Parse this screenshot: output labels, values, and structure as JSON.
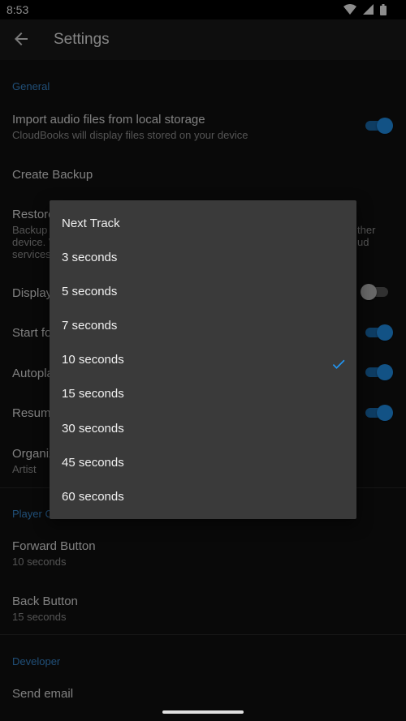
{
  "status_bar": {
    "time": "8:53"
  },
  "appbar": {
    "title": "Settings"
  },
  "sections": {
    "general": "General",
    "player": "Player C",
    "developer": "Developer"
  },
  "rows": {
    "import": {
      "title": "Import audio files from local storage",
      "subtitle": "CloudBooks will display files stored on your device",
      "toggle": true
    },
    "backup": {
      "title": "Create Backup"
    },
    "restore": {
      "title": "Restore",
      "line1": "Backup",
      "line1_tail": "ther",
      "line2": "device. V",
      "line2_tail": "ud",
      "line3": "services"
    },
    "display": {
      "title": "Display",
      "toggle": false
    },
    "start": {
      "title": "Start fo",
      "toggle": true
    },
    "autoplay": {
      "title": "Autopla",
      "toggle": true
    },
    "resume": {
      "title": "Resum",
      "toggle": true
    },
    "organize": {
      "title": "Organiz",
      "subtitle": "Artist"
    },
    "forward": {
      "title": "Forward Button",
      "subtitle": "10 seconds"
    },
    "backbtn": {
      "title": "Back Button",
      "subtitle": "15 seconds"
    },
    "email": {
      "title": "Send email"
    }
  },
  "menu": {
    "items": [
      "Next Track",
      "3 seconds",
      "5 seconds",
      "7 seconds",
      "10 seconds",
      "15 seconds",
      "30 seconds",
      "45 seconds",
      "60 seconds"
    ],
    "selected": "10 seconds"
  },
  "colors": {
    "accent": "#2196f3",
    "section": "#3b8fd9"
  }
}
